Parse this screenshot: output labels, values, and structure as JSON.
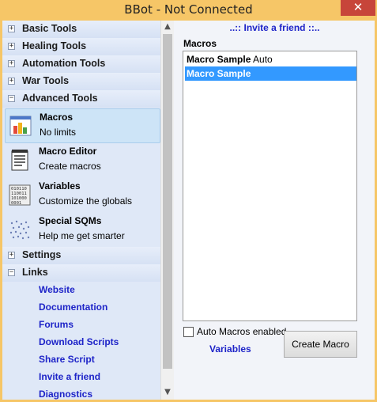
{
  "window": {
    "title": "BBot - Not Connected",
    "close_glyph": "✕"
  },
  "sidebar": {
    "categories": [
      {
        "label": "Basic Tools",
        "toggle": "+"
      },
      {
        "label": "Healing Tools",
        "toggle": "+"
      },
      {
        "label": "Automation Tools",
        "toggle": "+"
      },
      {
        "label": "War Tools",
        "toggle": "+"
      },
      {
        "label": "Advanced Tools",
        "toggle": "−"
      },
      {
        "label": "Settings",
        "toggle": "+"
      },
      {
        "label": "Links",
        "toggle": "−"
      }
    ],
    "advanced_tools": [
      {
        "name": "Macros",
        "description": "No limits",
        "icon": "macros-chart-icon",
        "selected": true
      },
      {
        "name": "Macro Editor",
        "description": "Create macros",
        "icon": "notepad-icon",
        "selected": false
      },
      {
        "name": "Variables",
        "description": "Customize the globals",
        "icon": "binary-icon",
        "selected": false
      },
      {
        "name": "Special SQMs",
        "description": "Help me get smarter",
        "icon": "dots-grid-icon",
        "selected": false
      }
    ],
    "links": [
      "Website",
      "Documentation",
      "Forums",
      "Download Scripts",
      "Share Script",
      "Invite a friend",
      "Diagnostics"
    ],
    "scroll_up_glyph": "▲",
    "scroll_down_glyph": "▼"
  },
  "main": {
    "invite_link": "..:: Invite a friend ::..",
    "macros_label": "Macros",
    "macros_list": [
      {
        "name": "Macro Sample",
        "suffix": " Auto",
        "selected": false
      },
      {
        "name": "Macro Sample",
        "suffix": "",
        "selected": true
      }
    ],
    "auto_macros_label": "Auto Macros enabled",
    "auto_macros_checked": false,
    "variables_link": "Variables",
    "create_button": "Create Macro"
  },
  "colors": {
    "title_bar": "#f6c667",
    "close_button": "#c7453a",
    "link": "#1e24c8",
    "selection": "#3399ff"
  }
}
